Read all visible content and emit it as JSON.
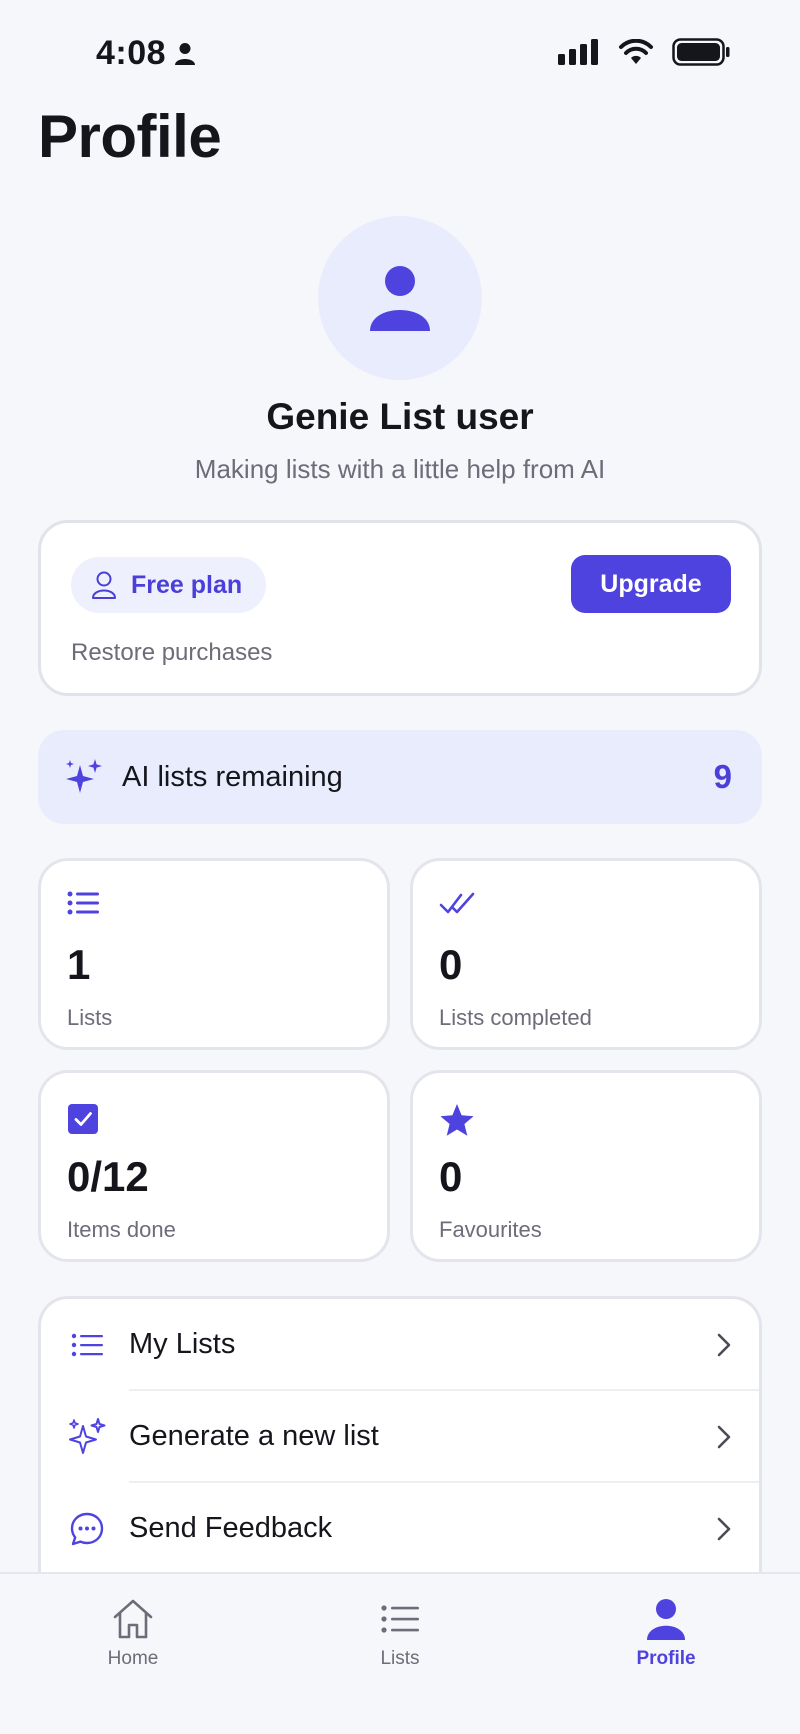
{
  "status_bar": {
    "time": "4:08"
  },
  "page": {
    "title": "Profile"
  },
  "user": {
    "name": "Genie List user",
    "tagline": "Making lists with a little help from AI"
  },
  "plan": {
    "plan_label": "Free plan",
    "upgrade_label": "Upgrade",
    "restore_label": "Restore purchases"
  },
  "ai": {
    "label": "AI lists remaining",
    "count": "9"
  },
  "stats": [
    {
      "value": "1",
      "label": "Lists",
      "icon": "list-icon"
    },
    {
      "value": "0",
      "label": "Lists completed",
      "icon": "double-check-icon"
    },
    {
      "value": "0/12",
      "label": "Items done",
      "icon": "checkbox-icon"
    },
    {
      "value": "0",
      "label": "Favourites",
      "icon": "star-icon"
    }
  ],
  "menu": [
    {
      "label": "My Lists",
      "icon": "list-icon"
    },
    {
      "label": "Generate a new list",
      "icon": "sparkles-icon"
    },
    {
      "label": "Send Feedback",
      "icon": "chat-bubble-icon"
    }
  ],
  "tabs": [
    {
      "label": "Home",
      "icon": "home-icon",
      "active": false
    },
    {
      "label": "Lists",
      "icon": "list-icon",
      "active": false
    },
    {
      "label": "Profile",
      "icon": "person-icon",
      "active": true
    }
  ],
  "colors": {
    "accent": "#4f43e0",
    "accent_soft": "#e9ecfd",
    "background": "#f6f7fb",
    "text_secondary": "#6c6d78"
  }
}
